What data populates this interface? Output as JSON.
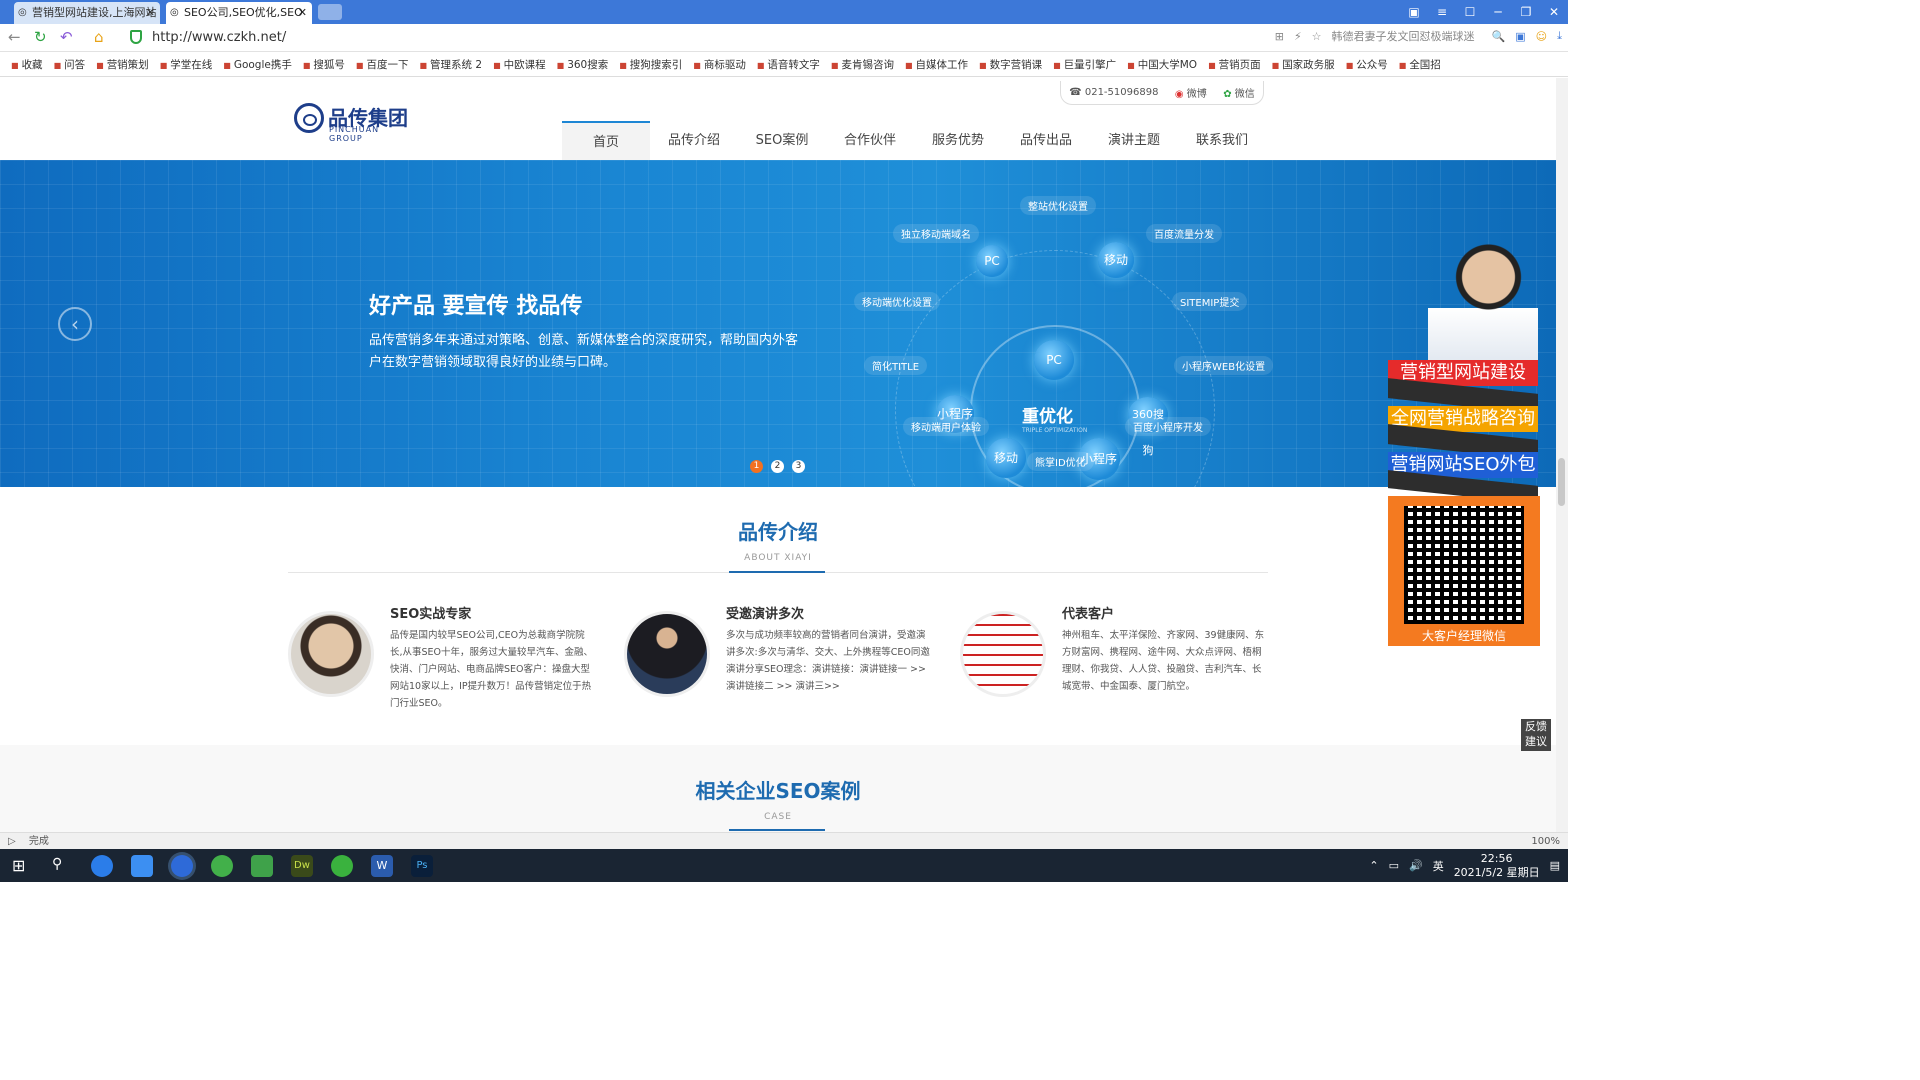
{
  "browser": {
    "tabs": [
      {
        "title": "营销型网站建设,上海网站"
      },
      {
        "title": "SEO公司,SEO优化,SEO"
      }
    ],
    "address": "http://www.czkh.net/",
    "search_hint": "韩德君妻子发文回怼极端球迷",
    "status_text": "完成",
    "zoom": "100%",
    "bookmarks": [
      "收藏",
      "问答",
      "营销策划",
      "学堂在线",
      "Google携手",
      "搜狐号",
      "百度一下",
      "管理系统 2",
      "中欧课程",
      "360搜索",
      "搜狗搜索引",
      "商标驱动",
      "语音转文字",
      "麦肯锡咨询",
      "自媒体工作",
      "数字营销课",
      "巨量引擎广",
      "中国大学MO",
      "营销页面",
      "国家政务服",
      "公众号",
      "全国招"
    ]
  },
  "site": {
    "logo_cn": "品传集团",
    "logo_en": "PINCHUAN GROUP",
    "phone": "021-51096898",
    "weibo": "微博",
    "wechat": "微信",
    "menu": [
      "首页",
      "品传介绍",
      "SEO案例",
      "合作伙伴",
      "服务优势",
      "品传出品",
      "演讲主题",
      "联系我们"
    ]
  },
  "banner": {
    "title": "好产品 要宣传 找品传",
    "desc": "品传营销多年来通过对策略、创意、新媒体整合的深度研究，帮助国内外客户在数字营销领域取得良好的业绩与口碑。",
    "center": "重优化",
    "center_sub": "TRIPLE OPTIMIZATION",
    "nodes": [
      "PC",
      "移动",
      "PC",
      "小程序",
      "360搜狗",
      "移动",
      "小程序"
    ],
    "tags": [
      "整站优化设置",
      "独立移动端域名",
      "百度流量分发",
      "移动端优化设置",
      "SITEMIP提交",
      "简化TITLE",
      "小程序WEB化设置",
      "移动端用户体验",
      "百度小程序开发",
      "熊掌ID优化"
    ],
    "dots": [
      "1",
      "2",
      "3"
    ]
  },
  "about": {
    "title": "品传介绍",
    "subtitle": "ABOUT XIAYI",
    "items": [
      {
        "title": "SEO实战专家",
        "text": "品传是国内较早SEO公司,CEO为总裁商学院院长,从事SEO十年，服务过大量较早汽车、金融、快消、门户网站、电商品牌SEO客户：操盘大型网站10家以上，IP提升数万！品传营销定位于热门行业SEO。"
      },
      {
        "title": "受邀演讲多次",
        "text": "多次与成功频率较高的营销者同台演讲，受邀演讲多次:多次与清华、交大、上外携程等CEO同邀演讲分享SEO理念：演讲链接：演讲链接一 >>    演讲链接二 >>    演讲三>>"
      },
      {
        "title": "代表客户",
        "text": "神州租车、太平洋保险、齐家网、39健康网、东方财富网、携程网、途牛网、大众点评网、梧桐理财、你我贷、人人贷、投融贷、吉利汽车、长城宽带、中金国泰、厦门航空。"
      }
    ]
  },
  "cases": {
    "title": "相关企业SEO案例",
    "subtitle": "CASE"
  },
  "floating": {
    "btn1": "营销型网站建设",
    "btn2": "全网营销战略咨询",
    "btn3": "营销网站SEO外包",
    "qr_caption": "大客户经理微信",
    "feedback": "反馈建议"
  },
  "taskbar": {
    "time": "22:56",
    "date": "2021/5/2 星期日",
    "ime": "英"
  },
  "colors": {
    "brand_blue": "#1e6bb0",
    "banner_blue": "#1a86d3",
    "orange": "#f47a20",
    "red": "#e52b2b",
    "yellow": "#f5a400"
  }
}
